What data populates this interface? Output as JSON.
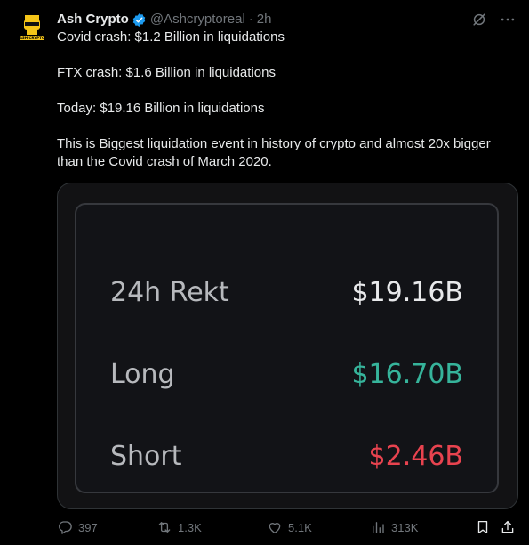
{
  "author": {
    "name": "Ash Crypto",
    "handle": "@Ashcryptoreal",
    "time": "2h",
    "avatar_text": "ASH CRYPTO",
    "verified_color": "#1d9bf0"
  },
  "tweet": {
    "lines": [
      "Covid crash: $1.2 Billion in liquidations",
      "FTX crash: $1.6 Billion in liquidations",
      "Today: $19.16 Billion in liquidations",
      "This is Biggest liquidation event in history of crypto and almost 20x bigger than the Covid crash of March 2020."
    ]
  },
  "media": {
    "rows": [
      {
        "label": "24h Rekt",
        "value": "$19.16B"
      },
      {
        "label": "Long",
        "value": "$16.70B",
        "color": "#36b49b"
      },
      {
        "label": "Short",
        "value": "$2.46B",
        "color": "#e8434f"
      }
    ]
  },
  "actions": {
    "replies": "397",
    "retweets": "1.3K",
    "likes": "5.1K",
    "views": "313K"
  },
  "icons": {
    "header": [
      "grok-icon",
      "more-icon"
    ],
    "actions": [
      "reply-icon",
      "retweet-icon",
      "like-icon",
      "views-icon",
      "bookmark-icon",
      "share-icon"
    ]
  }
}
